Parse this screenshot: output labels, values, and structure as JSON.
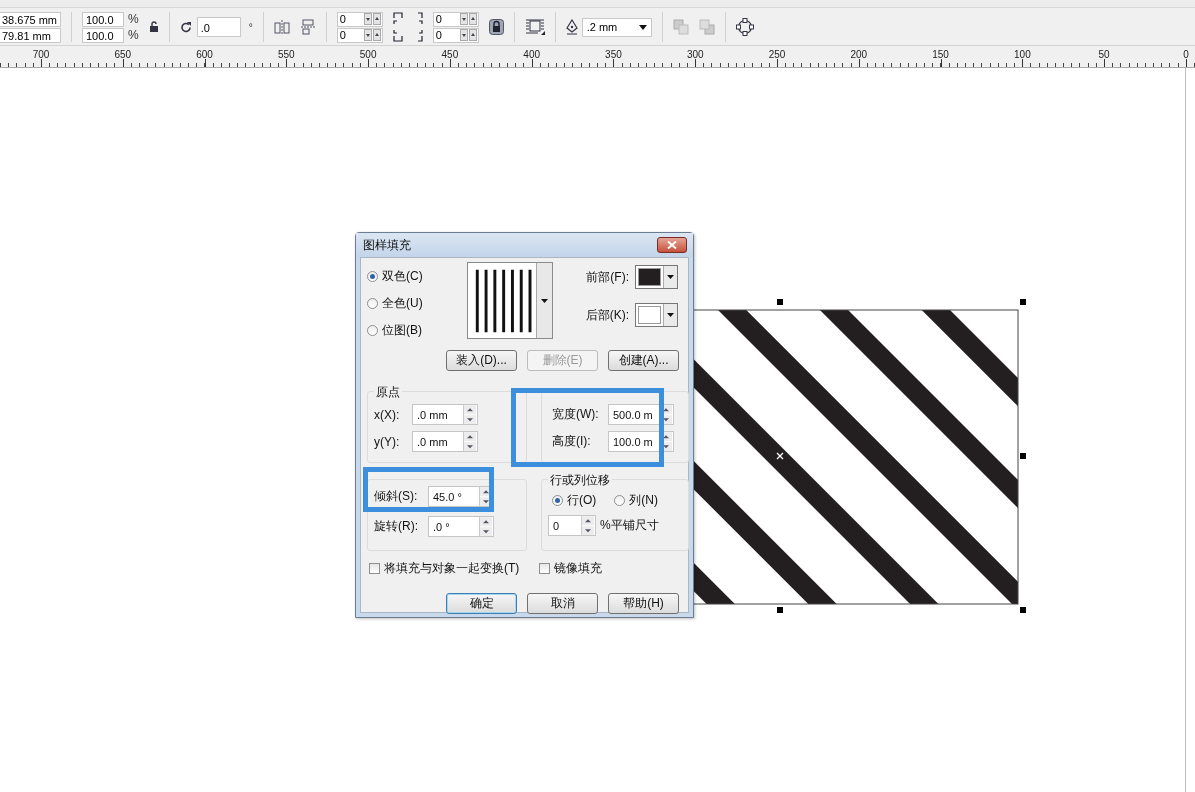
{
  "toolbar": {
    "position": [
      "38.675 mm",
      "79.81 mm"
    ],
    "scale": [
      {
        "value": "100.0",
        "unit": "%"
      },
      {
        "value": "100.0",
        "unit": "%"
      }
    ],
    "rotation": {
      "value": ".0",
      "unit": "°"
    },
    "offsets": [
      "0",
      "0"
    ],
    "corners": [
      "0",
      "0"
    ],
    "outline_width": ".2 mm"
  },
  "ruler": {
    "labels": [
      "700",
      "650",
      "600",
      "550",
      "500",
      "450",
      "400",
      "350",
      "300",
      "250",
      "200",
      "150",
      "100",
      "50",
      "0"
    ]
  },
  "dialog": {
    "title": "图样填充",
    "fill_types": [
      {
        "label": "双色(C)",
        "selected": true
      },
      {
        "label": "全色(U)",
        "selected": false
      },
      {
        "label": "位图(B)",
        "selected": false
      }
    ],
    "foreground": {
      "label": "前部(F):",
      "color": "#231f20"
    },
    "background": {
      "label": "后部(K):",
      "color": "#ffffff"
    },
    "pattern_buttons": [
      {
        "label": "装入(D)...",
        "disabled": false
      },
      {
        "label": "删除(E)",
        "disabled": true
      },
      {
        "label": "创建(A)...",
        "disabled": false
      }
    ],
    "origin": {
      "title": "原点",
      "fields": [
        {
          "label": "x(X):",
          "value": ".0 mm"
        },
        {
          "label": "y(Y):",
          "value": ".0 mm"
        }
      ]
    },
    "size": {
      "fields": [
        {
          "label": "宽度(W):",
          "value": "500.0 m"
        },
        {
          "label": "高度(I):",
          "value": "100.0 m"
        }
      ]
    },
    "transform": {
      "fields": [
        {
          "label": "倾斜(S):",
          "value": "45.0 °"
        },
        {
          "label": "旋转(R):",
          "value": ".0 °"
        }
      ]
    },
    "offset": {
      "title": "行或列位移",
      "options": [
        {
          "label": "行(O)",
          "selected": true
        },
        {
          "label": "列(N)",
          "selected": false
        }
      ],
      "value": "0",
      "unit": "%平铺尺寸"
    },
    "options": [
      {
        "label": "将填充与对象一起变换(T)",
        "checked": false
      },
      {
        "label": "镜像填充",
        "checked": false
      }
    ],
    "buttons": [
      {
        "label": "确定",
        "default": true
      },
      {
        "label": "取消",
        "default": false
      },
      {
        "label": "帮助(H)",
        "default": false
      }
    ]
  }
}
